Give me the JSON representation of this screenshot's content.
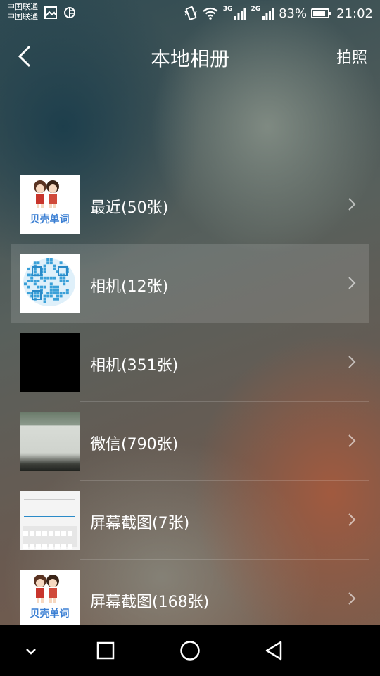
{
  "status_bar": {
    "carrier_1": "中国联通",
    "carrier_2": "中国联通",
    "network_1": "3G",
    "network_2": "2G",
    "battery_percent": "83%",
    "battery_level": 0.83,
    "time": "21:02",
    "icons": [
      "gallery-icon",
      "signal-app-icon",
      "vibrate-icon",
      "wifi-icon",
      "signal-icon",
      "battery-icon"
    ]
  },
  "header": {
    "title": "本地相册",
    "action": "拍照",
    "back_icon": "back-icon"
  },
  "albums": [
    {
      "label": "最近(50张)",
      "thumb": "shell"
    },
    {
      "label": "相机(12张)",
      "thumb": "qr",
      "selected": true
    },
    {
      "label": "相机(351张)",
      "thumb": "black"
    },
    {
      "label": "微信(790张)",
      "thumb": "photo"
    },
    {
      "label": "屏幕截图(7张)",
      "thumb": "screen"
    },
    {
      "label": "屏幕截图(168张)",
      "thumb": "shell"
    }
  ],
  "thumbnail_text": {
    "brand": "贝壳单词"
  },
  "colors": {
    "selected_row": "rgba(255,255,255,0.13)",
    "brand_blue": "#3b7fd3",
    "nav_bar": "#000000"
  },
  "nav_bar": {
    "icons": [
      "hide-nav-icon",
      "recent-apps-icon",
      "home-icon",
      "back-nav-icon"
    ]
  }
}
